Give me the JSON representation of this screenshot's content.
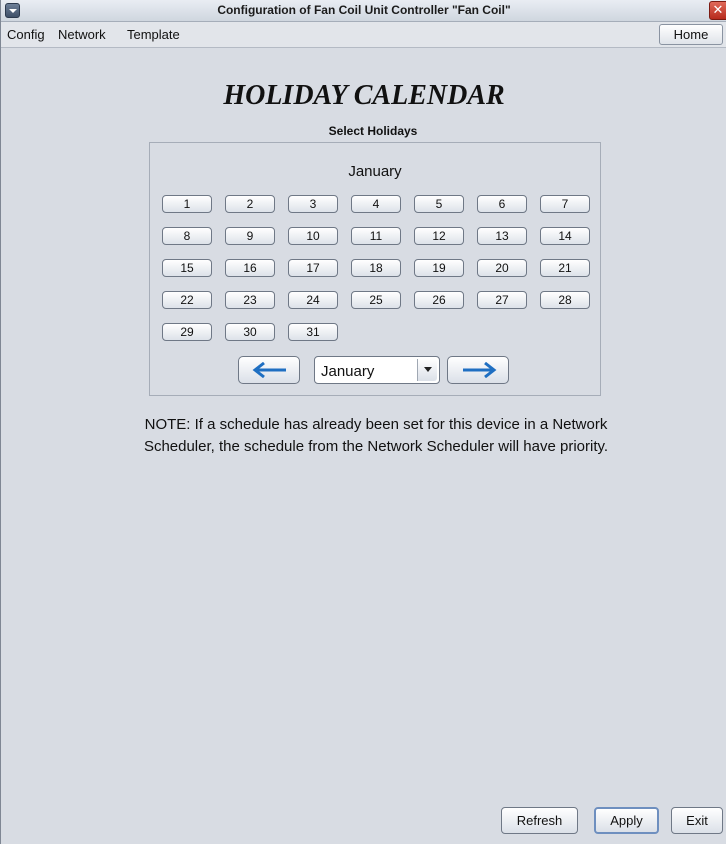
{
  "window": {
    "title": "Configuration of Fan Coil Unit Controller \"Fan Coil\"",
    "close_glyph": "✕"
  },
  "menu": {
    "items": [
      "Config",
      "Network",
      "Template"
    ],
    "home_label": "Home"
  },
  "page": {
    "title": "HOLIDAY CALENDAR",
    "subtitle": "Select Holidays"
  },
  "calendar": {
    "month_label": "January",
    "days": [
      "1",
      "2",
      "3",
      "4",
      "5",
      "6",
      "7",
      "8",
      "9",
      "10",
      "11",
      "12",
      "13",
      "14",
      "15",
      "16",
      "17",
      "18",
      "19",
      "20",
      "21",
      "22",
      "23",
      "24",
      "25",
      "26",
      "27",
      "28",
      "29",
      "30",
      "31"
    ],
    "month_select_value": "January",
    "prev_icon": "arrow-left-icon",
    "next_icon": "arrow-right-icon",
    "arrow_color": "#1f6fc2"
  },
  "note": {
    "line1": "NOTE: If a schedule has already been set for this device in a Network",
    "line2": "Scheduler, the schedule from the Network Scheduler will have priority."
  },
  "footer": {
    "refresh_label": "Refresh",
    "apply_label": "Apply",
    "exit_label": "Exit"
  }
}
